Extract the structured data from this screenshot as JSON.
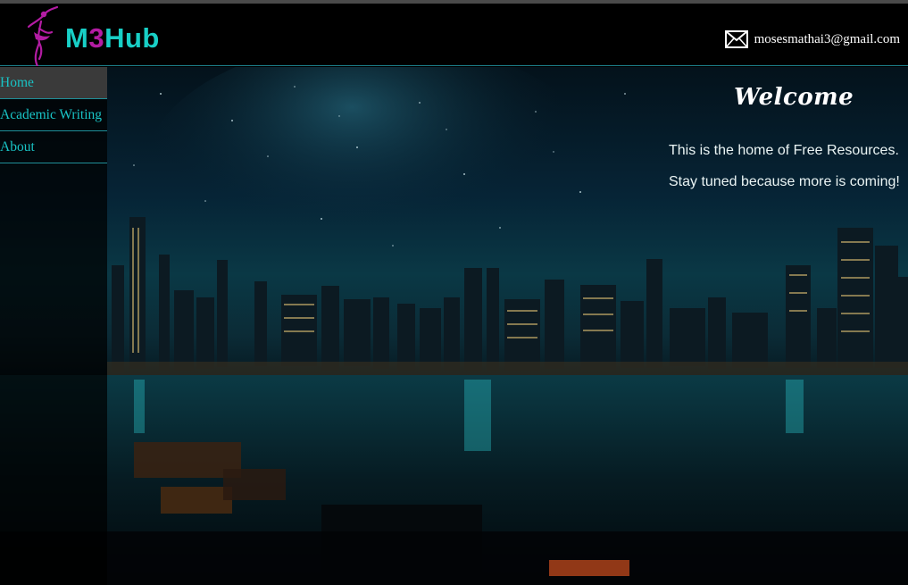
{
  "brand": {
    "part1": "M",
    "part2": "3",
    "part3": "Hub"
  },
  "contact": {
    "email": "mosesmathai3@gmail.com",
    "icon": "envelope-icon"
  },
  "nav": {
    "items": [
      {
        "label": "Home",
        "active": true
      },
      {
        "label": "Academic Writing",
        "active": false
      },
      {
        "label": "About",
        "active": false
      }
    ]
  },
  "main": {
    "welcome": "Welcome",
    "line1": "This is the home of Free Resources.",
    "line2": "Stay tuned because more is coming!"
  },
  "colors": {
    "teal": "#18cfc6",
    "magenta": "#b31ca3",
    "nav_border": "#1f8f98",
    "active_bg": "#3a3a3a"
  }
}
